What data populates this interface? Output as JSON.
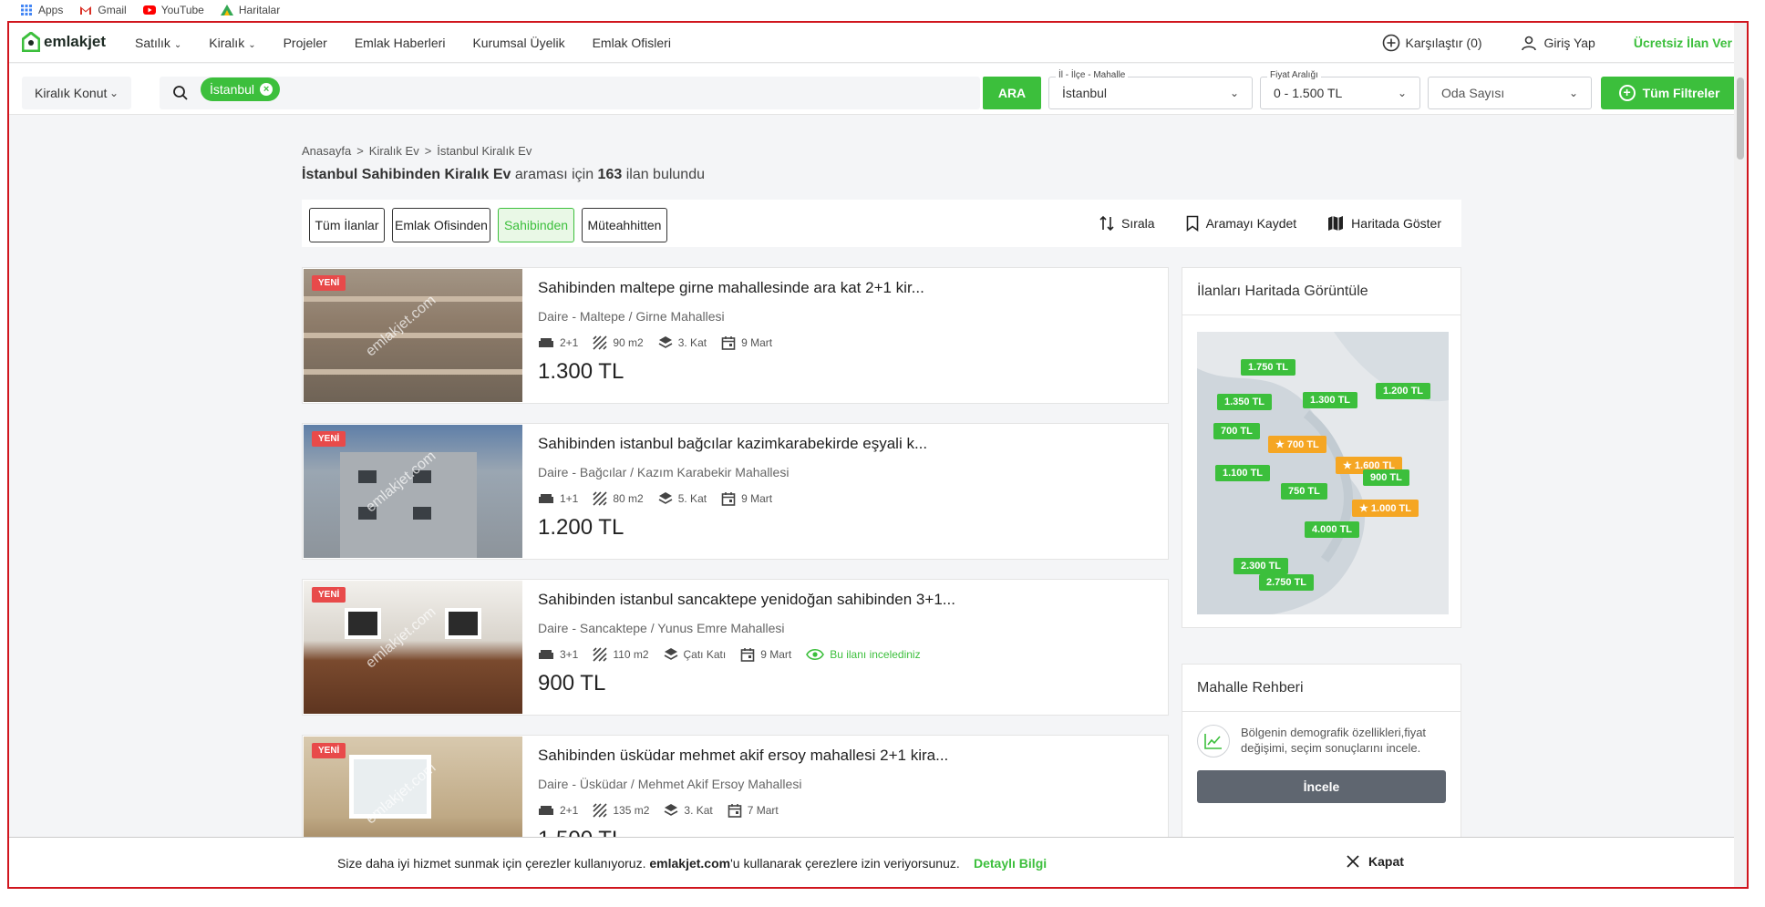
{
  "browser": {
    "bookmarks": [
      "Apps",
      "Gmail",
      "YouTube",
      "Haritalar"
    ]
  },
  "header": {
    "logo": "emlakjet",
    "nav": [
      "Satılık",
      "Kiralık",
      "Projeler",
      "Emlak Haberleri",
      "Kurumsal Üyelik",
      "Emlak Ofisleri"
    ],
    "compare": "Karşılaştır (0)",
    "login": "Giriş Yap",
    "free_listing": "Ücretsiz İlan Ver"
  },
  "search": {
    "category": "Kiralık Konut",
    "chip": "İstanbul",
    "search_button": "ARA",
    "location_label": "İl - İlçe - Mahalle",
    "location_value": "İstanbul",
    "price_label": "Fiyat Aralığı",
    "price_value": "0 - 1.500 TL",
    "rooms_value": "Oda Sayısı",
    "all_filters": "Tüm Filtreler"
  },
  "breadcrumb": [
    "Anasayfa",
    "Kiralık Ev",
    "İstanbul Kiralık Ev"
  ],
  "result": {
    "query": "İstanbul Sahibinden Kiralık Ev",
    "mid": "araması için",
    "count": "163",
    "suffix": "ilan bulundu"
  },
  "filter_tabs": [
    "Tüm İlanlar",
    "Emlak Ofisinden",
    "Sahibinden",
    "Müteahhitten"
  ],
  "tools": {
    "sort": "Sırala",
    "save": "Aramayı Kaydet",
    "map": "Haritada Göster"
  },
  "listings": [
    {
      "badge": "YENİ",
      "title": "Sahibinden maltepe girne mahallesinde ara kat 2+1 kir...",
      "location": "Daire - Maltepe / Girne Mahallesi",
      "rooms": "2+1",
      "area": "90 m2",
      "floor": "3. Kat",
      "date": "9 Mart",
      "price": "1.300 TL",
      "seen": ""
    },
    {
      "badge": "YENİ",
      "title": "Sahibinden istanbul bağcılar kazimkarabekirde eşyali k...",
      "location": "Daire - Bağcılar / Kazım Karabekir Mahallesi",
      "rooms": "1+1",
      "area": "80 m2",
      "floor": "5. Kat",
      "date": "9 Mart",
      "price": "1.200 TL",
      "seen": ""
    },
    {
      "badge": "YENİ",
      "title": "Sahibinden istanbul sancaktepe yenidoğan sahibinden 3+1...",
      "location": "Daire - Sancaktepe / Yunus Emre Mahallesi",
      "rooms": "3+1",
      "area": "110 m2",
      "floor": "Çatı Katı",
      "date": "9 Mart",
      "price": "900 TL",
      "seen": "Bu ilanı incelediniz"
    },
    {
      "badge": "YENİ",
      "title": "Sahibinden üsküdar mehmet akif ersoy mahallesi 2+1 kira...",
      "location": "Daire - Üsküdar / Mehmet Akif Ersoy Mahallesi",
      "rooms": "2+1",
      "area": "135 m2",
      "floor": "3. Kat",
      "date": "7 Mart",
      "price": "1.500 TL",
      "seen": ""
    }
  ],
  "watermark": "emlakjet.com",
  "map_card": {
    "title": "İlanları Haritada Görüntüle",
    "pins": [
      "1.750 TL",
      "1.350 TL",
      "1.300 TL",
      "1.200 TL",
      "700 TL",
      "700 TL",
      "1.600 TL",
      "1.100 TL",
      "900 TL",
      "750 TL",
      "1.000 TL",
      "4.000 TL",
      "2.300 TL",
      "2.750 TL"
    ]
  },
  "guide_card": {
    "title": "Mahalle Rehberi",
    "text": "Bölgenin demografik özellikleri,fiyat değişimi, seçim sonuçlarını incele.",
    "button": "İncele"
  },
  "cookie": {
    "text_pre": "Size daha iyi hizmet sunmak için çerezler kullanıyoruz.",
    "brand": "emlakjet.com",
    "text_post": "'u kullanarak çerezlere izin veriyorsunuz.",
    "more": "Detaylı Bilgi",
    "close": "Kapat"
  },
  "colors": {
    "brand_green": "#3cbf3c",
    "new_badge": "#e84a4a",
    "pin_orange": "#f5a623",
    "frame_red": "#d0161e"
  }
}
